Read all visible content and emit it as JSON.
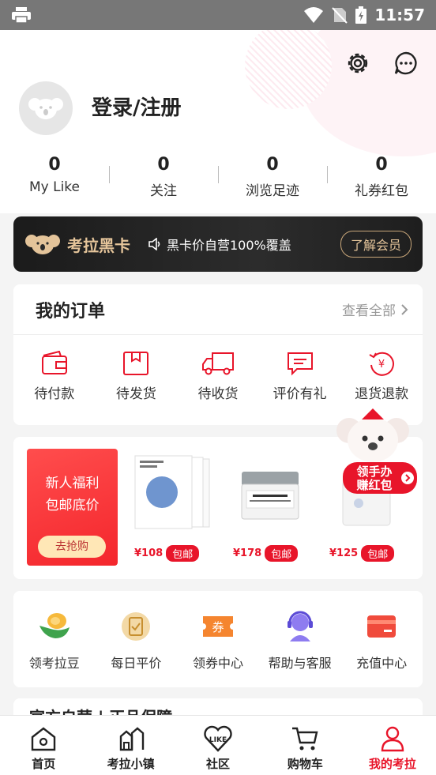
{
  "status_bar": {
    "time": "11:57"
  },
  "profile": {
    "login_text": "登录/注册"
  },
  "stats": [
    {
      "value": "0",
      "label": "My Like"
    },
    {
      "value": "0",
      "label": "关注"
    },
    {
      "value": "0",
      "label": "浏览足迹"
    },
    {
      "value": "0",
      "label": "礼券红包"
    }
  ],
  "black_card": {
    "title": "考拉黑卡",
    "subtitle": "黑卡价自营100%覆盖",
    "button": "了解会员"
  },
  "orders": {
    "title": "我的订单",
    "view_all": "查看全部",
    "items": [
      {
        "label": "待付款",
        "icon": "wallet-icon"
      },
      {
        "label": "待发货",
        "icon": "package-icon"
      },
      {
        "label": "待收货",
        "icon": "truck-icon"
      },
      {
        "label": "评价有礼",
        "icon": "comment-icon"
      },
      {
        "label": "退货退款",
        "icon": "refund-icon"
      }
    ]
  },
  "promo": {
    "line1": "新人福利",
    "line2": "包邮底价",
    "button": "去抢购",
    "products": [
      {
        "price": "¥108",
        "tag": "包邮"
      },
      {
        "price": "¥178",
        "tag": "包邮"
      },
      {
        "price": "¥125",
        "tag": "包邮"
      }
    ],
    "koala_badge_line1": "领手办",
    "koala_badge_line2": "赚红包"
  },
  "services": [
    {
      "label": "领考拉豆",
      "icon": "bean-icon"
    },
    {
      "label": "每日平价",
      "icon": "daily-price-icon"
    },
    {
      "label": "领券中心",
      "icon": "coupon-icon"
    },
    {
      "label": "帮助与客服",
      "icon": "service-icon"
    },
    {
      "label": "充值中心",
      "icon": "recharge-icon"
    }
  ],
  "partial_section_title": "官方自营 | 正品保障",
  "tabs": [
    {
      "label": "首页",
      "icon": "home-icon"
    },
    {
      "label": "考拉小镇",
      "icon": "town-icon"
    },
    {
      "label": "社区",
      "icon": "like-icon"
    },
    {
      "label": "购物车",
      "icon": "cart-icon"
    },
    {
      "label": "我的考拉",
      "icon": "user-icon",
      "active": true
    }
  ],
  "colors": {
    "accent": "#e8152a",
    "gold": "#e4c49a"
  }
}
